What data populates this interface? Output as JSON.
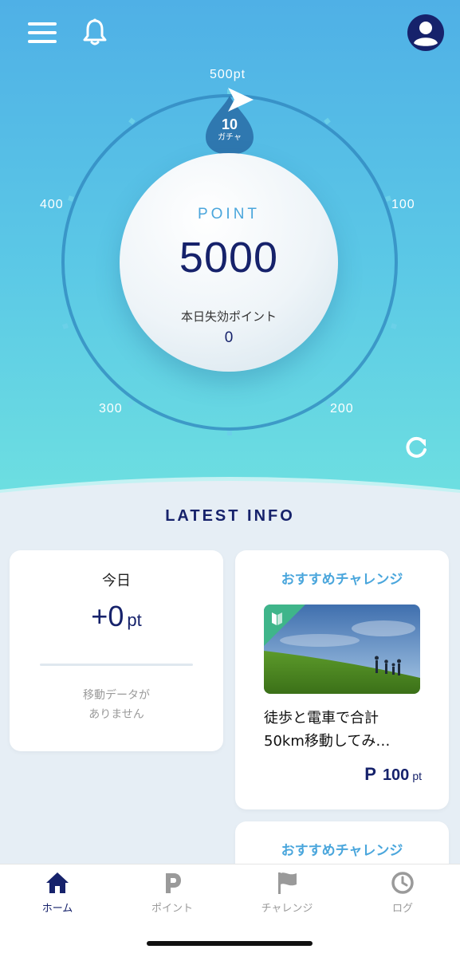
{
  "header": {
    "menu_icon": "hamburger-menu-icon",
    "bell_icon": "bell-icon",
    "avatar_icon": "user-avatar-icon"
  },
  "dial": {
    "ticks": [
      "500pt",
      "100",
      "200",
      "300",
      "400"
    ],
    "marker_count": "10",
    "marker_label": "ガチャ",
    "point_label": "POINT",
    "point_value": "5000",
    "expire_label": "本日失効ポイント",
    "expire_value": "0",
    "refresh_icon": "refresh-icon"
  },
  "latest": {
    "title": "LATEST INFO",
    "today": {
      "label": "今日",
      "value": "+0",
      "unit": "pt",
      "empty_line1": "移動データが",
      "empty_line2": "ありません"
    },
    "challenge": {
      "title": "おすすめチャレンジ",
      "badge_icon": "beginner-mark-icon",
      "text_line1": "徒歩と電車で合計",
      "text_line2": "50km移動してみ…",
      "point_symbol": "P",
      "points": "100",
      "unit": "pt"
    },
    "challenge2": {
      "title": "おすすめチャレンジ"
    }
  },
  "nav": {
    "items": [
      {
        "label": "ホーム",
        "icon": "home-icon"
      },
      {
        "label": "ポイント",
        "icon": "point-icon"
      },
      {
        "label": "チャレンジ",
        "icon": "flag-icon"
      },
      {
        "label": "ログ",
        "icon": "clock-icon"
      }
    ]
  },
  "colors": {
    "primary": "#16226b",
    "accent": "#4aa6dc",
    "nav_inactive": "#9a9a9a"
  }
}
